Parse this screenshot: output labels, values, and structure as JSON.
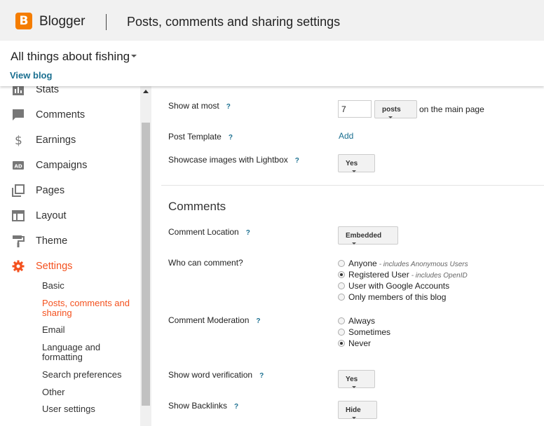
{
  "header": {
    "brand": "Blogger",
    "title": "Posts, comments and sharing settings"
  },
  "blog": {
    "name": "All things about fishing",
    "view_link": "View blog"
  },
  "sidebar": {
    "items": [
      {
        "label": "Stats",
        "icon": "stats-icon"
      },
      {
        "label": "Comments",
        "icon": "comment-icon"
      },
      {
        "label": "Earnings",
        "icon": "dollar-icon"
      },
      {
        "label": "Campaigns",
        "icon": "ad-icon"
      },
      {
        "label": "Pages",
        "icon": "pages-icon"
      },
      {
        "label": "Layout",
        "icon": "layout-icon"
      },
      {
        "label": "Theme",
        "icon": "paint-roller-icon"
      },
      {
        "label": "Settings",
        "icon": "gear-icon",
        "active": true
      }
    ],
    "settings_sub": [
      {
        "label": "Basic"
      },
      {
        "label": "Posts, comments and sharing",
        "active": true
      },
      {
        "label": "Email"
      },
      {
        "label": "Language and formatting"
      },
      {
        "label": "Search preferences"
      },
      {
        "label": "Other"
      },
      {
        "label": "User settings"
      }
    ]
  },
  "posts": {
    "show_at_most_label": "Show at most",
    "show_at_most_value": "7",
    "unit_select": "posts",
    "unit_suffix": "on the main page",
    "template_label": "Post Template",
    "template_link": "Add",
    "lightbox_label": "Showcase images with Lightbox",
    "lightbox_value": "Yes"
  },
  "comments": {
    "section_title": "Comments",
    "location_label": "Comment Location",
    "location_value": "Embedded",
    "who_label": "Who can comment?",
    "who_options": [
      {
        "label": "Anyone",
        "note": "- includes Anonymous Users",
        "selected": false
      },
      {
        "label": "Registered User",
        "note": "- includes OpenID",
        "selected": true
      },
      {
        "label": "User with Google Accounts",
        "note": "",
        "selected": false
      },
      {
        "label": "Only members of this blog",
        "note": "",
        "selected": false
      }
    ],
    "moderation_label": "Comment Moderation",
    "moderation_options": [
      {
        "label": "Always",
        "selected": false
      },
      {
        "label": "Sometimes",
        "selected": false
      },
      {
        "label": "Never",
        "selected": true
      }
    ],
    "word_verification_label": "Show word verification",
    "word_verification_value": "Yes",
    "backlinks_label": "Show Backlinks",
    "backlinks_value": "Hide"
  },
  "help_glyph": "?",
  "colors": {
    "accent": "#f4511e",
    "logo": "#f57d00",
    "link": "#1a6f90",
    "header_bg": "#f1f1f1"
  }
}
